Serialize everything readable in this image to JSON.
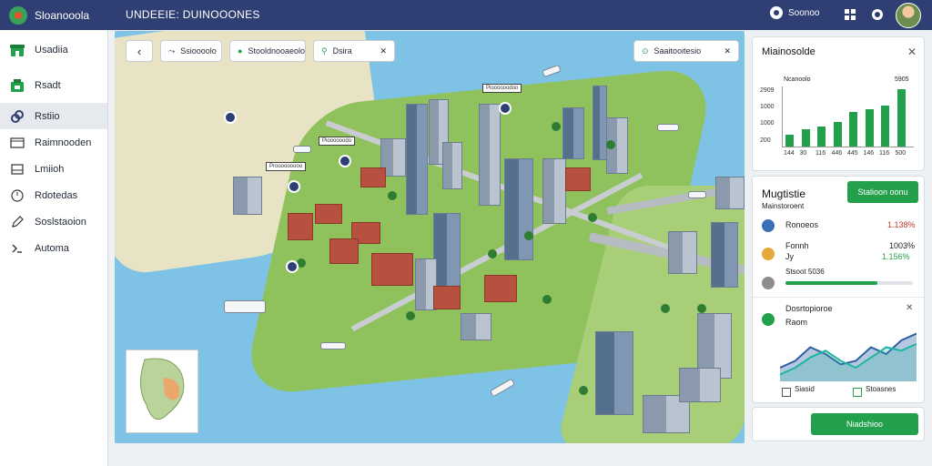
{
  "app": {
    "brand": "Sloanooola",
    "title": "UNDEEIE: DUINOOONES"
  },
  "topbar": {
    "user_label": "Soonoo"
  },
  "sidebar": {
    "items": [
      {
        "label": "Usadiia",
        "icon": "store-icon"
      },
      {
        "label": "Rsadt",
        "icon": "shop-icon"
      },
      {
        "label": "Rstiio",
        "icon": "link-icon",
        "active": true
      },
      {
        "label": "Raimnooden",
        "icon": "window-icon"
      },
      {
        "label": "Lmiioh",
        "icon": "tray-icon"
      },
      {
        "label": "Rdotedas",
        "icon": "clock-icon"
      },
      {
        "label": "Soslstaoion",
        "icon": "pencil-icon"
      },
      {
        "label": "Automa",
        "icon": "terminal-icon"
      }
    ]
  },
  "map": {
    "chips": [
      {
        "label": "Ssioooolo"
      },
      {
        "label": "Stooldnooaeolo"
      },
      {
        "label": "Dsira"
      }
    ],
    "search": {
      "label": "Saaitooitesio"
    },
    "markers": [
      "Pioooooodoo",
      "Pioooooodo",
      "Prooooooooo"
    ]
  },
  "chart_panel": {
    "title": "Miainosolde",
    "legend_label": "Ncanoolo",
    "top_value": "5905",
    "chart_data": {
      "type": "bar",
      "categories": [
        "144",
        "30",
        "116",
        "446",
        "445",
        "146",
        "116",
        "500"
      ],
      "values": [
        1200,
        1750,
        2050,
        2500,
        3600,
        3800,
        4200,
        5900
      ],
      "ylim": [
        0,
        6000
      ],
      "yticks": [
        "5905",
        "2909",
        "1000",
        "1000",
        "200"
      ]
    }
  },
  "detail_panel": {
    "title": "Mugtistie",
    "subtitle": "Mainstoroent",
    "action_label": "Stalioon oonu",
    "rows": [
      {
        "label": "Ronoeos",
        "value": "1.138%",
        "color": "#3b6fb6",
        "value_color": "#c0392b"
      },
      {
        "label": "Fonnh",
        "sub": "Jy",
        "value": "1003%",
        "value2": "1.156%",
        "color": "#e7a93a",
        "value_color": "#22a04b"
      },
      {
        "label": "Stsoot 5036",
        "progress": 0.72,
        "color": "#8d8d8d"
      }
    ]
  },
  "trend_panel": {
    "title": "Dosrtopioroe",
    "subtitle": "Raom",
    "legend": [
      "Siasid",
      "Stoasnes"
    ],
    "chart_data": {
      "type": "area",
      "series": [
        {
          "values": [
            2,
            3,
            5,
            4,
            2.5,
            3,
            5,
            4,
            6,
            7
          ]
        },
        {
          "values": [
            1,
            2,
            3.5,
            4.5,
            3,
            2,
            3.5,
            5,
            4.5,
            5.5
          ]
        }
      ]
    }
  },
  "footer": {
    "action_label": "Niadshioo"
  }
}
